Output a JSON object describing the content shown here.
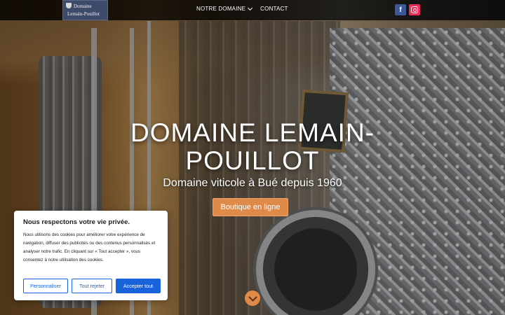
{
  "header": {
    "logo_line1": "Domaine",
    "logo_line2": "Lemain-Pouillot",
    "nav": [
      {
        "label": "NOTRE DOMAINE"
      },
      {
        "label": "CONTACT"
      }
    ],
    "social": {
      "facebook_glyph": "f",
      "icons": [
        "facebook-icon",
        "instagram-icon"
      ]
    }
  },
  "hero": {
    "title": "DOMAINE LEMAIN-POUILLOT",
    "subtitle": "Domaine viticole à Bué depuis 1960",
    "cta_label": "Boutique en ligne",
    "scroll_icon": "chevron-down-icon"
  },
  "cookie": {
    "title": "Nous respectons votre vie privée.",
    "text": "Nous utilisons des cookies pour améliorer votre expérience de navigation, diffuser des publicités ou des contenus personnalisés et analyser notre trafic. En cliquant sur « Tout accepter », vous consentez à notre utilisation des cookies.",
    "buttons": {
      "customize": "Personnaliser",
      "reject": "Tout rejeter",
      "accept": "Accepter tout"
    }
  },
  "colors": {
    "accent": "#e08a4a",
    "cookie_blue": "#1863dc",
    "facebook": "#3b5998",
    "instagram": "#ea2c59"
  }
}
